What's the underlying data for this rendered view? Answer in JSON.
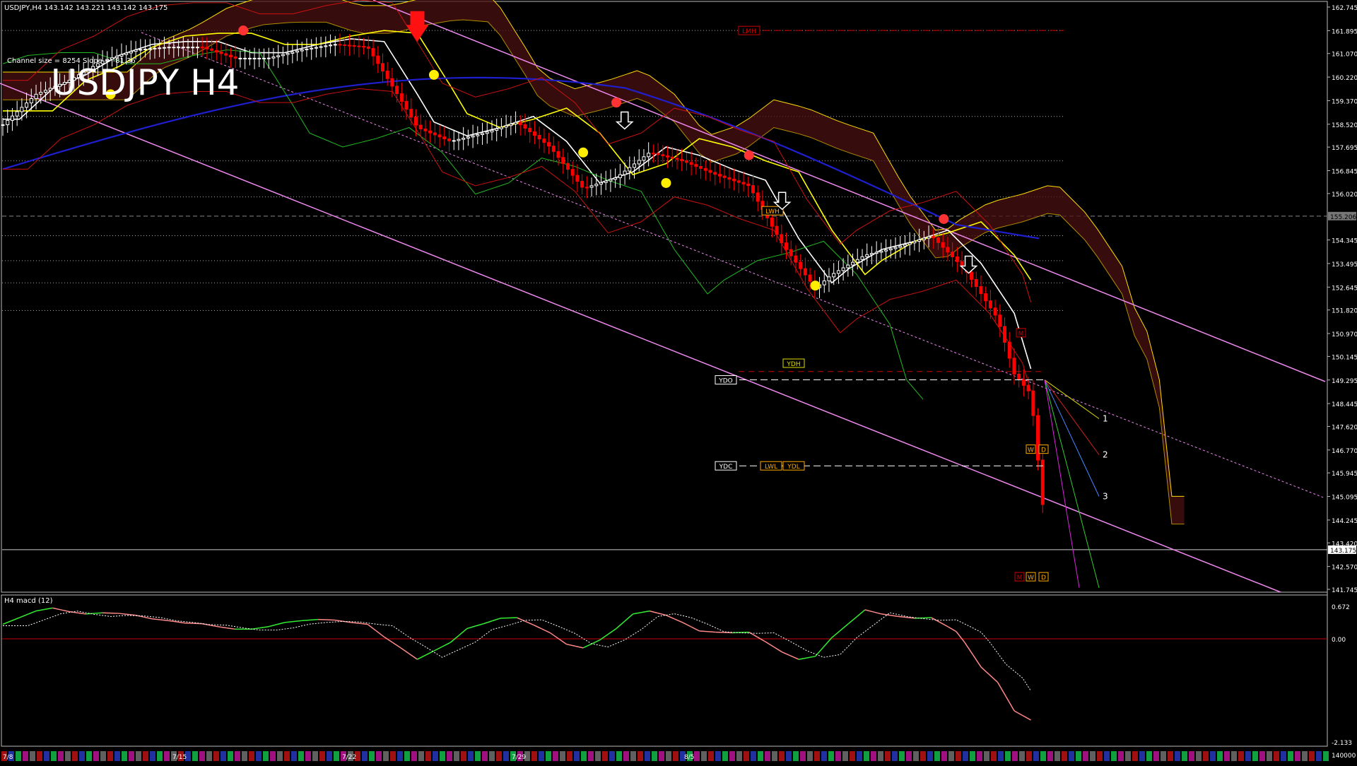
{
  "header": {
    "symbol_info": "USDJPY,H4  143.142 143.221 143.142 143.175",
    "big_title": "USDJPY H4",
    "channel_info": "Channel size = 8254 Slope = -81.36",
    "macd_label": "H4  macd (12)"
  },
  "colors": {
    "background": "#000000",
    "bull_candle": "#ffffff",
    "bear_candle": "#ff0000",
    "ma_white": "#ffffff",
    "ma_yellow": "#ffff00",
    "ma_blue": "#1f1fd0",
    "cloud": "#b08c00",
    "channel": "#ee88ee",
    "chikou": "#22bb22",
    "macd_up": "#33ee33",
    "macd_down": "#ff8888",
    "zero_line": "#cc0000"
  },
  "chart_data": {
    "type": "line",
    "instrument": "USDJPY",
    "timeframe": "H4",
    "ylim": [
      141.745,
      162.745
    ],
    "current_price": 143.175,
    "highlighted_level": 155.206,
    "price_axis_ticks": [
      "162.745",
      "161.895",
      "161.070",
      "160.220",
      "159.370",
      "158.520",
      "157.695",
      "156.845",
      "156.020",
      "155.206",
      "154.345",
      "153.495",
      "152.645",
      "151.820",
      "150.970",
      "150.145",
      "149.295",
      "148.445",
      "147.620",
      "146.770",
      "145.945",
      "145.095",
      "144.245",
      "143.420",
      "143.175",
      "142.570",
      "141.745"
    ],
    "date_labels": [
      "7/8",
      "7/15",
      "7/22",
      "7/29",
      "8/5"
    ],
    "x": [
      0,
      8,
      16,
      24,
      32,
      40,
      48,
      56,
      64,
      72,
      80,
      88,
      96,
      100,
      108,
      116,
      124,
      132,
      140,
      148,
      156,
      164,
      172,
      180,
      188,
      196,
      200,
      208,
      216,
      224,
      232,
      240,
      244,
      248,
      252
    ],
    "close": [
      158.5,
      159.6,
      160.1,
      160.8,
      161.2,
      161.3,
      161.3,
      160.9,
      160.9,
      161.2,
      161.4,
      161.3,
      159.4,
      158.4,
      157.9,
      158.2,
      158.6,
      157.7,
      156.2,
      156.6,
      157.5,
      157.2,
      156.7,
      156.3,
      154.2,
      152.6,
      153.1,
      153.8,
      154.1,
      154.5,
      153.3,
      151.5,
      149.5,
      148.8,
      143.2
    ],
    "high": [
      159.2,
      160.0,
      160.6,
      161.3,
      161.8,
      161.6,
      161.5,
      161.2,
      161.2,
      161.5,
      161.7,
      161.9,
      161.5,
      159.2,
      158.4,
      158.6,
      158.9,
      158.1,
      156.9,
      157.0,
      157.7,
      157.5,
      157.0,
      156.6,
      155.1,
      153.4,
      153.6,
      154.2,
      154.6,
      155.0,
      154.2,
      152.1,
      150.6,
      149.5,
      149.1
    ],
    "low": [
      157.8,
      158.9,
      159.6,
      160.3,
      160.8,
      160.8,
      160.8,
      160.5,
      160.4,
      160.8,
      161.0,
      160.9,
      159.1,
      157.6,
      157.2,
      157.8,
      158.1,
      157.0,
      155.7,
      156.1,
      157.0,
      156.7,
      156.1,
      155.5,
      152.9,
      151.9,
      152.6,
      153.4,
      153.6,
      154.1,
      152.9,
      149.7,
      149.0,
      148.4,
      141.9
    ],
    "levels": [
      {
        "label": "LMH",
        "price": 161.9
      },
      {
        "label": "YDH",
        "price": 149.9
      },
      {
        "label": "YDO",
        "price": 149.3
      },
      {
        "label": "YDC",
        "price": 146.2
      },
      {
        "label": "LWL",
        "price": 146.2
      },
      {
        "label": "YDL",
        "price": 146.2
      },
      {
        "label": "LWH",
        "price": 155.4
      },
      {
        "label": "M",
        "price": 151.0
      },
      {
        "label": "W",
        "price": 146.8
      },
      {
        "label": "D",
        "price": 146.8
      },
      {
        "label": "M",
        "price": 142.2
      },
      {
        "label": "W",
        "price": 142.2
      },
      {
        "label": "D",
        "price": 142.2
      }
    ],
    "projections": [
      "1",
      "2",
      "3"
    ],
    "macd": {
      "axis_ticks": [
        "0.672",
        "0.00",
        "-2.133",
        "140000"
      ],
      "ylim": [
        -2.133,
        0.672
      ]
    }
  }
}
